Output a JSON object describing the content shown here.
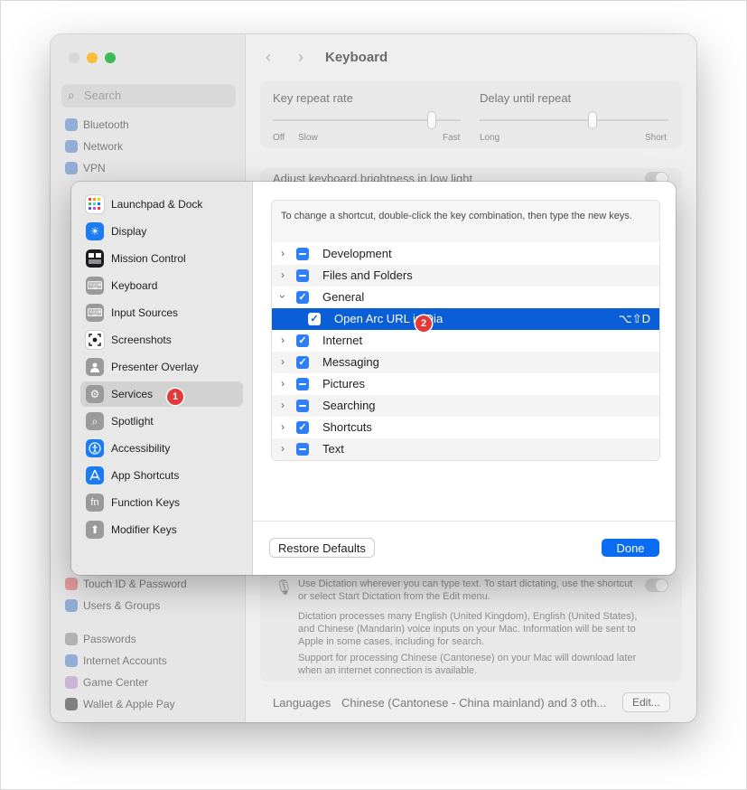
{
  "background": {
    "search_placeholder": "Search",
    "sidebar_items": [
      "Bluetooth",
      "Network",
      "VPN",
      "Touch ID & Password",
      "Users & Groups",
      "Passwords",
      "Internet Accounts",
      "Game Center",
      "Wallet & Apple Pay"
    ],
    "window_title": "Keyboard",
    "key_repeat_rate_label": "Key repeat rate",
    "key_repeat_ticks": [
      "Off",
      "Slow",
      "Fast"
    ],
    "delay_until_repeat_label": "Delay until repeat",
    "delay_ticks": [
      "Long",
      "Short"
    ],
    "brightness_label": "Adjust keyboard brightness in low light",
    "dictation_text_1": "Use Dictation wherever you can type text. To start dictating, use the shortcut or select Start Dictation from the Edit menu.",
    "dictation_text_2": "Dictation processes many English (United Kingdom), English (United States), and Chinese (Mandarin) voice inputs on your Mac. Information will be sent to Apple in some cases, including for search.",
    "dictation_text_3": "Support for processing Chinese (Cantonese) on your Mac will download later when an internet connection is available.",
    "languages_label": "Languages",
    "languages_value": "Chinese (Cantonese - China mainland) and 3 oth...",
    "edit_button": "Edit..."
  },
  "sidebar": {
    "items": [
      {
        "label": "Launchpad & Dock",
        "icon": "launchpad-icon",
        "color": "#ffffff"
      },
      {
        "label": "Display",
        "icon": "display-icon",
        "color": "#1a7cf0"
      },
      {
        "label": "Mission Control",
        "icon": "mission-control-icon",
        "color": "#1c1c1e"
      },
      {
        "label": "Keyboard",
        "icon": "keyboard-icon",
        "color": "#9a9a9a"
      },
      {
        "label": "Input Sources",
        "icon": "input-sources-icon",
        "color": "#9a9a9a"
      },
      {
        "label": "Screenshots",
        "icon": "screenshots-icon",
        "color": "#ffffff"
      },
      {
        "label": "Presenter Overlay",
        "icon": "presenter-overlay-icon",
        "color": "#9a9a9a"
      },
      {
        "label": "Services",
        "icon": "services-icon",
        "color": "#9a9a9a"
      },
      {
        "label": "Spotlight",
        "icon": "spotlight-icon",
        "color": "#9a9a9a"
      },
      {
        "label": "Accessibility",
        "icon": "accessibility-icon",
        "color": "#1a7cf0"
      },
      {
        "label": "App Shortcuts",
        "icon": "app-shortcuts-icon",
        "color": "#1a7cf0"
      },
      {
        "label": "Function Keys",
        "icon": "function-keys-icon",
        "color": "#9a9a9a"
      },
      {
        "label": "Modifier Keys",
        "icon": "modifier-keys-icon",
        "color": "#9a9a9a"
      }
    ],
    "selected": "Services"
  },
  "annotations": {
    "badge1": "1",
    "badge2": "2"
  },
  "main": {
    "hint": "To change a shortcut, double-click the key combination, then type the new keys.",
    "rows": [
      {
        "label": "Development",
        "state": "mixed",
        "expanded": false
      },
      {
        "label": "Files and Folders",
        "state": "mixed",
        "expanded": false
      },
      {
        "label": "General",
        "state": "checked",
        "expanded": true
      },
      {
        "label": "Open Arc URL in Dia",
        "state": "checked",
        "child": true,
        "shortcut": "⌥⇧D"
      },
      {
        "label": "Internet",
        "state": "checked",
        "expanded": false
      },
      {
        "label": "Messaging",
        "state": "checked",
        "expanded": false
      },
      {
        "label": "Pictures",
        "state": "mixed",
        "expanded": false
      },
      {
        "label": "Searching",
        "state": "mixed",
        "expanded": false
      },
      {
        "label": "Shortcuts",
        "state": "checked",
        "expanded": false
      },
      {
        "label": "Text",
        "state": "mixed",
        "expanded": false
      }
    ],
    "restore_button": "Restore Defaults",
    "done_button": "Done"
  },
  "colors": {
    "accent": "#0a6cf2",
    "selection": "#0a5ed7",
    "badge": "#e5383b"
  }
}
